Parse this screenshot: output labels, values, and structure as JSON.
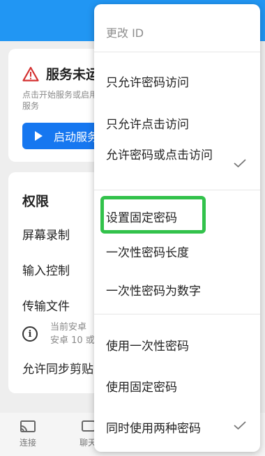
{
  "service": {
    "title": "服务未运",
    "desc": "点击开始服务或启用服务",
    "start_label": "启动服务"
  },
  "permissions": {
    "title": "权限",
    "items": [
      "屏幕录制",
      "输入控制",
      "传输文件"
    ],
    "info": [
      "当前安卓",
      "安卓 10 或"
    ],
    "clipboard": "允许同步剪贴"
  },
  "bottom_nav": {
    "connect": "连接",
    "chat": "聊天"
  },
  "menu": {
    "header": "更改 ID",
    "items": [
      "只允许密码访问",
      "只允许点击访问",
      "允许密码或点击访问",
      "设置固定密码",
      "一次性密码长度",
      "一次性密码为数字",
      "使用一次性密码",
      "使用固定密码",
      "同时使用两种密码"
    ]
  },
  "colors": {
    "appbar": "#2196f3",
    "primary_button": "#1677f0",
    "warning": "#d32f2f",
    "highlight": "#32c24b"
  },
  "icons": {
    "warning": "warning-triangle-icon",
    "play": "play-icon",
    "info": "info-icon",
    "cast": "cast-icon",
    "check": "checkmark-icon"
  }
}
